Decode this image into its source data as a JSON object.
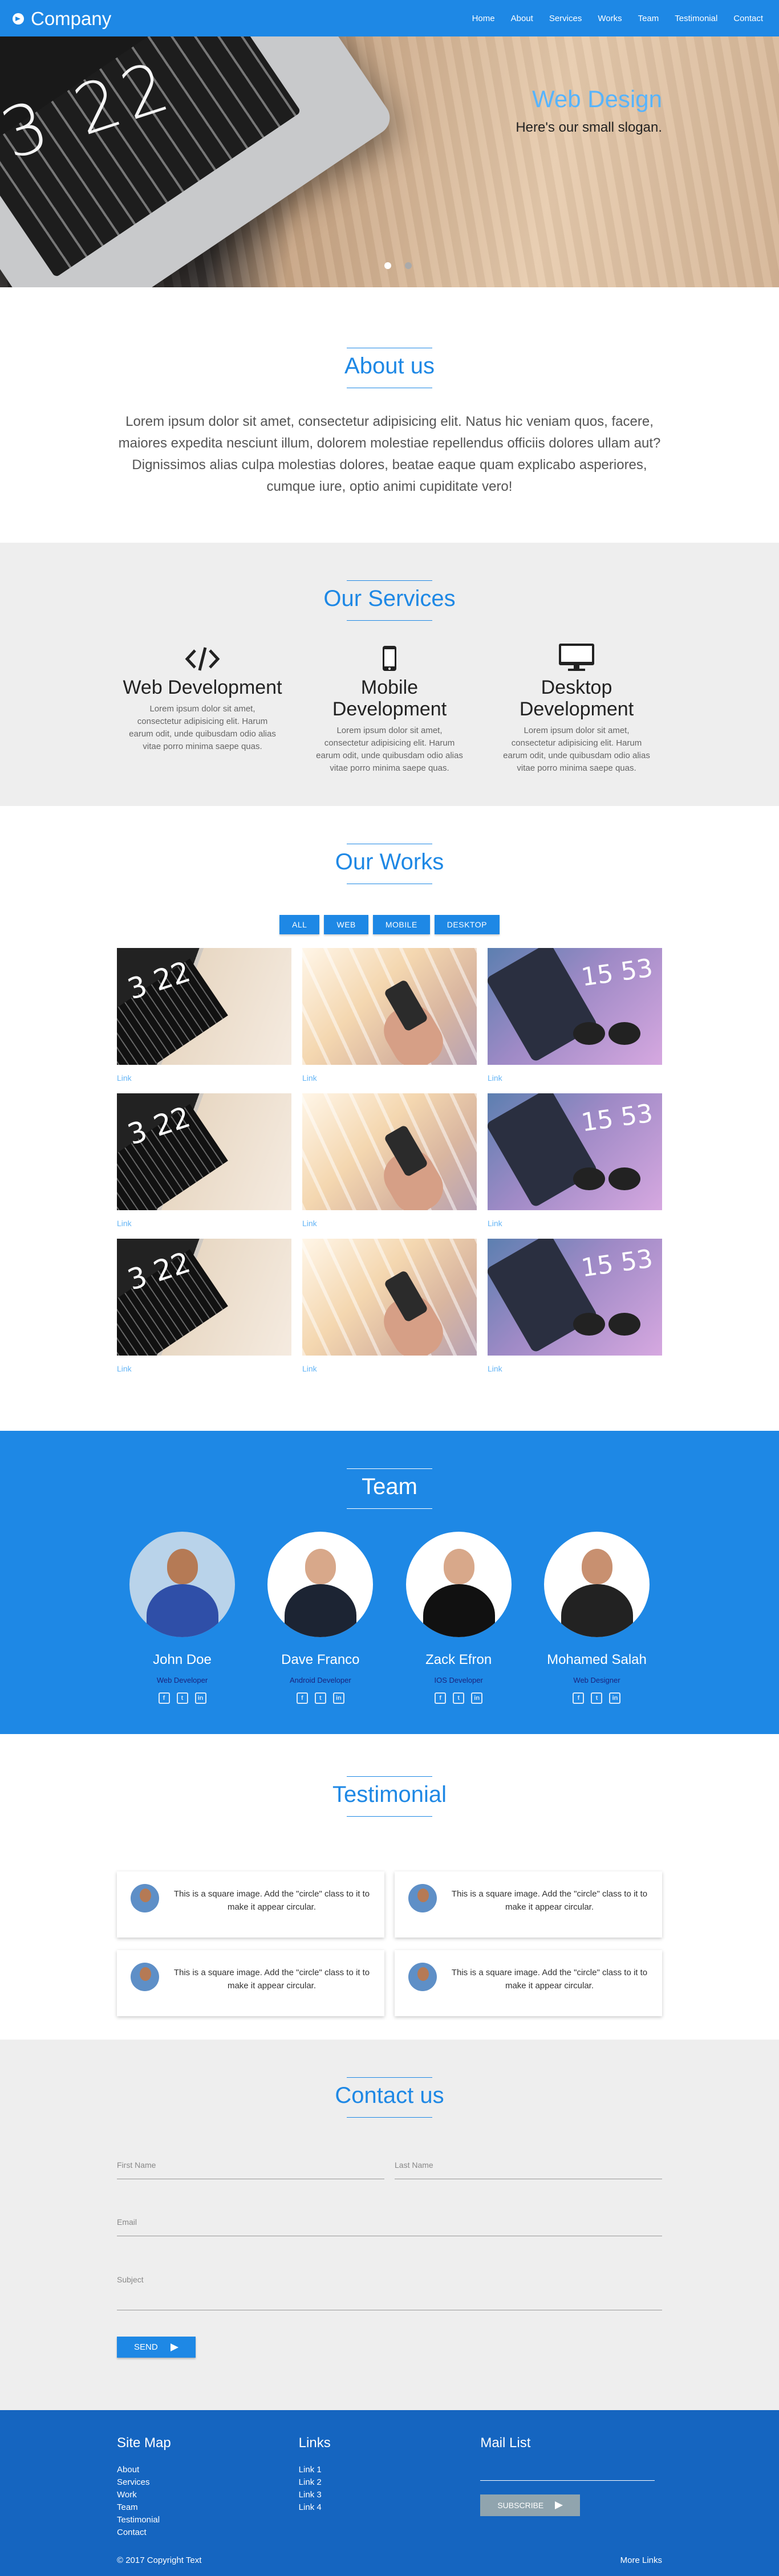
{
  "nav": {
    "brand": "Company",
    "items": [
      "Home",
      "About",
      "Services",
      "Works",
      "Team",
      "Testimonial",
      "Contact"
    ]
  },
  "hero": {
    "clock": "3 22",
    "title": "Web Design",
    "slogan": "Here's our small slogan.",
    "slides": 2,
    "active_slide": 1
  },
  "about": {
    "title": "About us",
    "text": "Lorem ipsum dolor sit amet, consectetur adipisicing elit. Natus hic veniam quos, facere, maiores expedita nesciunt illum, dolorem molestiae repellendus officiis dolores ullam aut? Dignissimos alias culpa molestias dolores, beatae eaque quam explicabo asperiores, cumque iure, optio animi cupiditate vero!"
  },
  "services": {
    "title": "Our Services",
    "items": [
      {
        "icon": "code-icon",
        "name": "Web Development",
        "text": "Lorem ipsum dolor sit amet, consectetur adipisicing elit. Harum earum odit, unde quibusdam odio alias vitae porro minima saepe quas."
      },
      {
        "icon": "mobile-icon",
        "name": "Mobile Development",
        "text": "Lorem ipsum dolor sit amet, consectetur adipisicing elit. Harum earum odit, unde quibusdam odio alias vitae porro minima saepe quas."
      },
      {
        "icon": "desktop-icon",
        "name": "Desktop Development",
        "text": "Lorem ipsum dolor sit amet, consectetur adipisicing elit. Harum earum odit, unde quibusdam odio alias vitae porro minima saepe quas."
      }
    ]
  },
  "works": {
    "title": "Our Works",
    "filters": [
      "ALL",
      "WEB",
      "MOBILE",
      "DESKTOP"
    ],
    "link_label": "Link",
    "thumb_clock": "3 22",
    "thumb_time": "15 53"
  },
  "team": {
    "title": "Team",
    "members": [
      {
        "name": "John Doe",
        "role": "Web Developer"
      },
      {
        "name": "Dave Franco",
        "role": "Android Developer"
      },
      {
        "name": "Zack Efron",
        "role": "IOS Developer"
      },
      {
        "name": "Mohamed Salah",
        "role": "Web Designer"
      }
    ],
    "social": [
      "f",
      "t",
      "in"
    ],
    "colors": {
      "accent": "#1e88e5"
    }
  },
  "testimonial": {
    "title": "Testimonial",
    "quote": "This is a square image. Add the \"circle\" class to it to make it appear circular."
  },
  "contact": {
    "title": "Contact us",
    "first_name": "First Name",
    "last_name": "Last Name",
    "email": "Email",
    "subject": "Subject",
    "send": "SEND"
  },
  "footer": {
    "sitemap_title": "Site Map",
    "sitemap": [
      "About",
      "Services",
      "Work",
      "Team",
      "Testimonial",
      "Contact"
    ],
    "links_title": "Links",
    "links": [
      "Link 1",
      "Link 2",
      "Link 3",
      "Link 4"
    ],
    "mail_title": "Mail List",
    "subscribe": "SUBSCRIBE",
    "copyright": "© 2017 Copyright Text",
    "more": "More Links"
  }
}
